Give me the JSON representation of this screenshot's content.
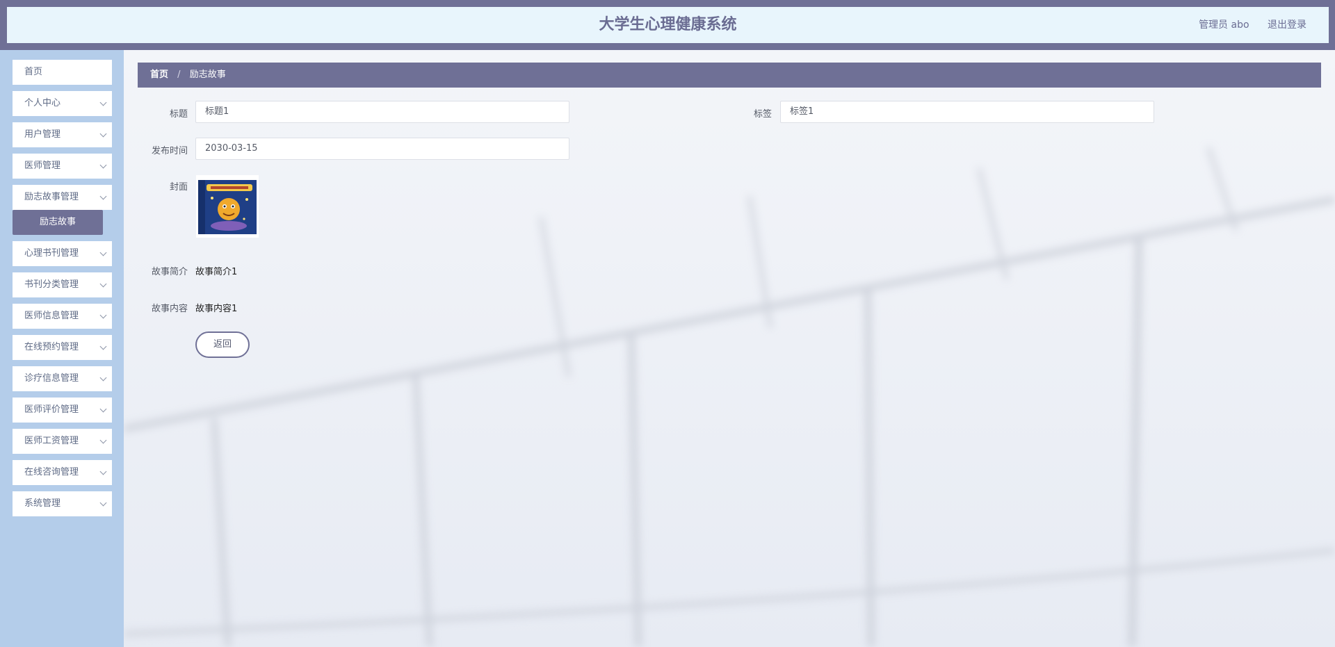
{
  "header": {
    "title": "大学生心理健康系统",
    "user_label": "管理员 abo",
    "logout_label": "退出登录"
  },
  "sidebar": {
    "items": [
      {
        "label": "首页",
        "has_children": false
      },
      {
        "label": "个人中心",
        "has_children": true
      },
      {
        "label": "用户管理",
        "has_children": true
      },
      {
        "label": "医师管理",
        "has_children": true
      },
      {
        "label": "励志故事管理",
        "has_children": true
      },
      {
        "label": "心理书刊管理",
        "has_children": true
      },
      {
        "label": "书刊分类管理",
        "has_children": true
      },
      {
        "label": "医师信息管理",
        "has_children": true
      },
      {
        "label": "在线预约管理",
        "has_children": true
      },
      {
        "label": "诊疗信息管理",
        "has_children": true
      },
      {
        "label": "医师评价管理",
        "has_children": true
      },
      {
        "label": "医师工资管理",
        "has_children": true
      },
      {
        "label": "在线咨询管理",
        "has_children": true
      },
      {
        "label": "系统管理",
        "has_children": true
      }
    ],
    "active_submenu": "励志故事"
  },
  "breadcrumb": {
    "home": "首页",
    "separator": "/",
    "current": "励志故事"
  },
  "form": {
    "title_label": "标题",
    "title_value": "标题1",
    "tag_label": "标签",
    "tag_value": "标签1",
    "publish_time_label": "发布时间",
    "publish_time_value": "2030-03-15",
    "cover_label": "封面",
    "summary_label": "故事简介",
    "summary_value": "故事简介1",
    "content_label": "故事内容",
    "content_value": "故事内容1",
    "back_button": "返回"
  },
  "colors": {
    "accent": "#6f7096",
    "header_bg": "#e8f5fc",
    "sidebar_bg": "#b4cdea"
  }
}
